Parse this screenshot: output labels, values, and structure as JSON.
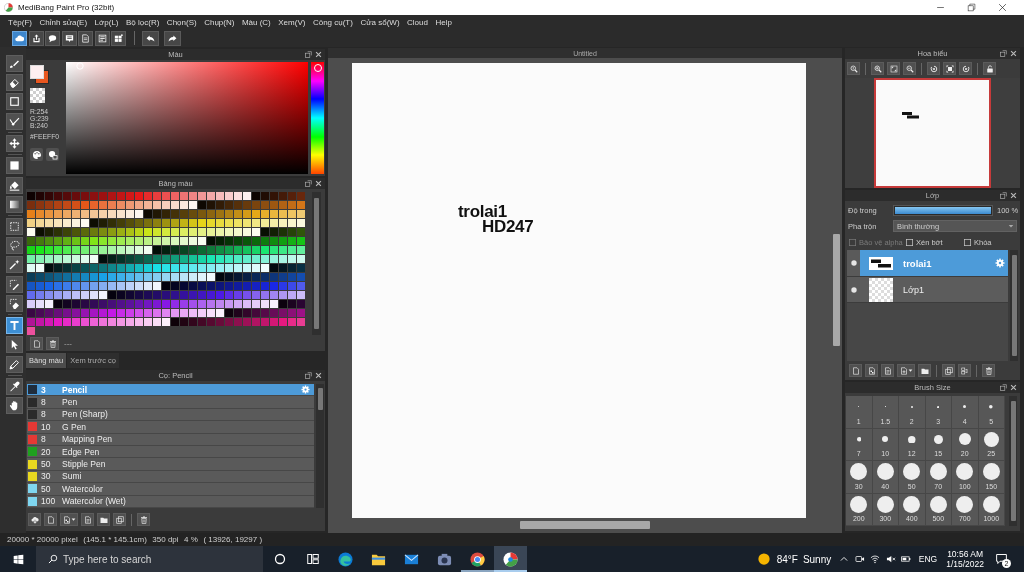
{
  "window": {
    "title": "MediBang Paint Pro (32bit)"
  },
  "menu": [
    "Tệp(F)",
    "Chỉnh sửa(E)",
    "Lớp(L)",
    "Bộ lọc(R)",
    "Chọn(S)",
    "Chụp(N)",
    "Màu (C)",
    "Xem(V)",
    "Công cụ(T)",
    "Cửa sổ(W)",
    "Cloud",
    "Help"
  ],
  "tools": [
    {
      "kind": "brush",
      "selected": false
    },
    {
      "kind": "eraser",
      "selected": false
    },
    {
      "kind": "rectangle",
      "selected": false
    },
    {
      "kind": "polyline",
      "selected": false
    },
    {
      "kind": "move",
      "selected": false
    },
    {
      "kind": "fill",
      "selected": false
    },
    {
      "kind": "bucket",
      "selected": false
    },
    {
      "kind": "gradient",
      "selected": false
    },
    {
      "kind": "select",
      "selected": false
    },
    {
      "kind": "lasso",
      "selected": false
    },
    {
      "kind": "wand",
      "selected": false
    },
    {
      "kind": "select-pen",
      "selected": false
    },
    {
      "kind": "select-eraser",
      "selected": false
    },
    {
      "kind": "text",
      "selected": true
    },
    {
      "kind": "operation",
      "selected": false
    },
    {
      "kind": "pen",
      "selected": false
    },
    {
      "kind": "dropper",
      "selected": false
    },
    {
      "kind": "hand",
      "selected": false
    }
  ],
  "color_panel": {
    "title": "Màu",
    "foreground": {
      "color": "#feeff0"
    },
    "background": {
      "color": "#e8561f"
    },
    "rgb": [
      "R:254",
      "G:239",
      "B:240"
    ],
    "hex": "#FEEFF0",
    "hue_slider": {
      "level": 0.02
    }
  },
  "palette_panel": {
    "title": "Bảng màu",
    "palette_name": "---",
    "tabs": [
      {
        "label": "Bảng màu",
        "selected": true
      },
      {
        "label": "Xem trước cọ",
        "selected": false
      }
    ]
  },
  "brush_panel": {
    "title": "Cọ: Pencil",
    "brushes": [
      {
        "size": "3",
        "name": "Pencil",
        "color": "#1f2d3d",
        "selected": true
      },
      {
        "size": "8",
        "name": "Pen",
        "color": "#2a2a2a",
        "selected": false
      },
      {
        "size": "8",
        "name": "Pen (Sharp)",
        "color": "#2a2a2a",
        "selected": false
      },
      {
        "size": "10",
        "name": "G Pen",
        "color": "#e53935",
        "selected": false
      },
      {
        "size": "8",
        "name": "Mapping Pen",
        "color": "#e53935",
        "selected": false
      },
      {
        "size": "20",
        "name": "Edge Pen",
        "color": "#1fa01f",
        "selected": false
      },
      {
        "size": "50",
        "name": "Stipple Pen",
        "color": "#e8d820",
        "selected": false
      },
      {
        "size": "30",
        "name": "Sumi",
        "color": "#e8d820",
        "selected": false
      },
      {
        "size": "50",
        "name": "Watercolor",
        "color": "#7fd6f0",
        "selected": false
      },
      {
        "size": "100",
        "name": "Watercolor (Wet)",
        "color": "#7fd6f0",
        "selected": false
      }
    ]
  },
  "canvas": {
    "title": "Untitled",
    "texts": [
      "trolai1",
      "HD247"
    ]
  },
  "navigator": {
    "title": "Hoa biểu"
  },
  "layer_panel": {
    "title": "Lớp",
    "opacity": {
      "label": "Độ trong",
      "level": 1,
      "reading": "100 %"
    },
    "blend": {
      "label": "Pha trộn",
      "value": "Bình thường"
    },
    "options": [
      {
        "label": "Bảo vệ alpha",
        "checked": false,
        "disabled": true
      },
      {
        "label": "Xén bớt",
        "checked": false,
        "disabled": false
      },
      {
        "label": "Khóa",
        "checked": false,
        "disabled": false
      }
    ],
    "layers": [
      {
        "name": "trolai1",
        "kind": "text",
        "visible": true,
        "selected": true
      },
      {
        "name": "Lớp1",
        "kind": "blank",
        "visible": true,
        "selected": false
      }
    ]
  },
  "brush_size_panel": {
    "title": "Brush Size",
    "sizes": [
      "1",
      "1.5",
      "2",
      "3",
      "4",
      "5",
      "7",
      "10",
      "12",
      "15",
      "20",
      "25",
      "30",
      "40",
      "50",
      "70",
      "100",
      "150",
      "200",
      "300",
      "400",
      "500",
      "700",
      "1000"
    ]
  },
  "status_bar": [
    "20000 * 20000 pixel",
    "(145.1 * 145.1cm)",
    "350 dpi",
    "4 %",
    "( 13926, 19297 )"
  ],
  "taskbar": {
    "search": {
      "placeholder": "Type here to search"
    },
    "apps": [
      {
        "kind": "edge",
        "running": false,
        "selected": false
      },
      {
        "kind": "explorer",
        "running": false,
        "selected": false
      },
      {
        "kind": "mail",
        "running": false,
        "selected": false
      },
      {
        "kind": "camera",
        "running": false,
        "selected": false
      },
      {
        "kind": "chrome",
        "running": true,
        "selected": false
      },
      {
        "kind": "medibang",
        "running": true,
        "selected": true
      }
    ],
    "weather": {
      "temperature": "84°F",
      "condition": "Sunny"
    },
    "language": "ENG",
    "time": "10:56 AM",
    "date": "1/15/2022",
    "notifications": "2"
  }
}
